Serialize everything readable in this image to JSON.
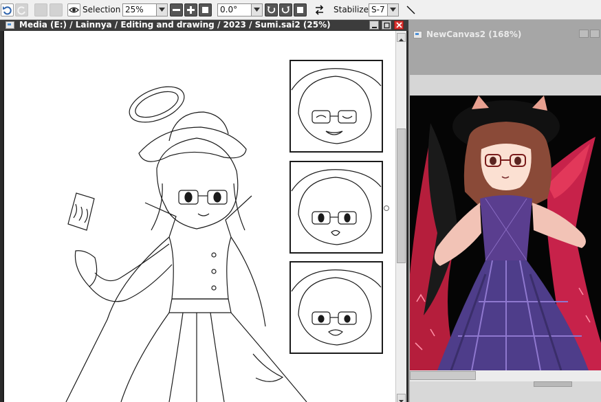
{
  "toolbar": {
    "selection_label": "Selection",
    "zoom_value": "25%",
    "rotation_value": "0.0°",
    "stabilizer_label": "Stabilizer",
    "stabilizer_value": "S-7"
  },
  "main_window": {
    "title": "Media (E:) / Lainnya / Editing and drawing / 2023 / Sumi.sai2 (25%)"
  },
  "second_window": {
    "title": "NewCanvas2 (168%)"
  },
  "icons": {
    "undo": "undo-icon",
    "redo": "redo-icon",
    "view": "eye-icon",
    "zoom_out": "minus-icon",
    "zoom_in": "plus-icon",
    "zoom_reset": "square-icon",
    "rotate_ccw": "rotate-left-icon",
    "rotate_cw": "rotate-right-icon",
    "flip": "flip-icon",
    "pen": "diagonal-line-icon"
  },
  "colors": {
    "toolbar_bg": "#f0f0f0",
    "title_bar": "#3c3c3c",
    "close_button": "#d9322f",
    "canvas_bg": "#ffffff",
    "dark_canvas_bg": "#050505"
  }
}
